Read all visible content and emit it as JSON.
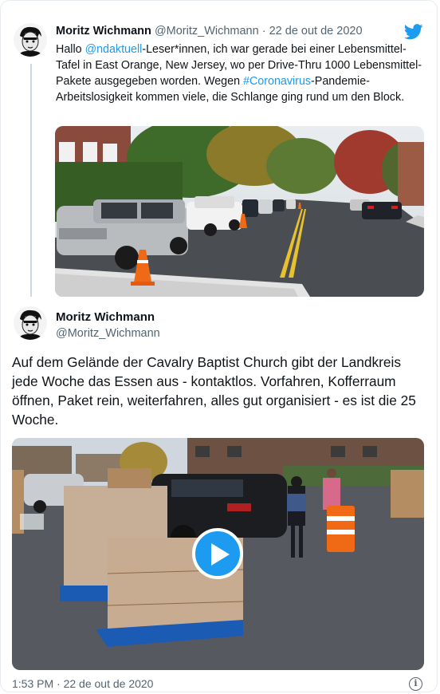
{
  "tweet1": {
    "name": "Moritz Wichmann",
    "handle": "@Moritz_Wichmann",
    "separator": "·",
    "date": "22 de out de 2020",
    "text_part1": "Hallo ",
    "mention": "@ndaktuell",
    "text_part2": "-Leser*innen, ich war gerade bei einer Lebensmittel-Tafel in East Orange, New Jersey, wo per Drive-Thru 1000 Lebensmittel-Pakete ausgegeben worden. Wegen ",
    "hashtag": "#Coronavirus",
    "text_part3": "-Pandemie-Arbeitslosigkeit kommen viele, die Schlange ging rund um den Block."
  },
  "tweet2": {
    "name": "Moritz Wichmann",
    "handle": "@Moritz_Wichmann",
    "text": "Auf dem Gelände der Cavalry Baptist Church gibt der Landkreis jede Woche das Essen aus - kontaktlos. Vorfahren, Kofferraum öffnen, Paket rein, weiterfahren, alles gut organisiert - es ist die 25 Woche.",
    "timestamp": "1:53 PM · 22 de out de 2020"
  },
  "icons": {
    "brand": "twitter-bird-icon",
    "play": "play-icon",
    "info": "info-icon"
  },
  "colors": {
    "accent": "#1d9bf0",
    "text": "#0f1419",
    "muted": "#536471"
  }
}
